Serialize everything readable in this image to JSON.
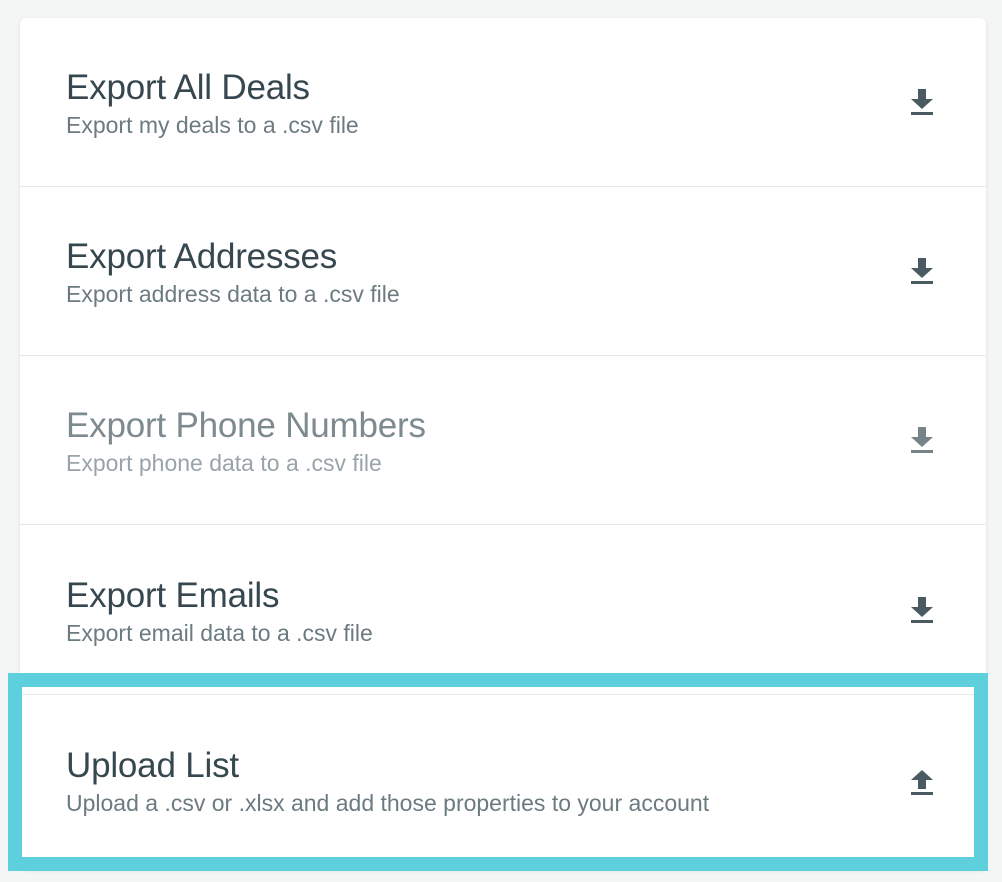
{
  "rows": [
    {
      "title": "Export All Deals",
      "subtitle": "Export my deals to a .csv file",
      "icon": "download-icon"
    },
    {
      "title": "Export Addresses",
      "subtitle": "Export address data to a .csv file",
      "icon": "download-icon"
    },
    {
      "title": "Export Phone Numbers",
      "subtitle": "Export phone data to a .csv file",
      "icon": "download-icon",
      "disabled": true
    },
    {
      "title": "Export Emails",
      "subtitle": "Export email data to a .csv file",
      "icon": "download-icon"
    },
    {
      "title": "Upload List",
      "subtitle": "Upload a .csv or .xlsx and add those properties to your account",
      "icon": "upload-icon",
      "highlighted": true
    }
  ],
  "colors": {
    "text_primary": "#36474f",
    "text_secondary": "#6c7b80",
    "highlight": "#5dcfdd",
    "icon": "#4a5a61"
  }
}
